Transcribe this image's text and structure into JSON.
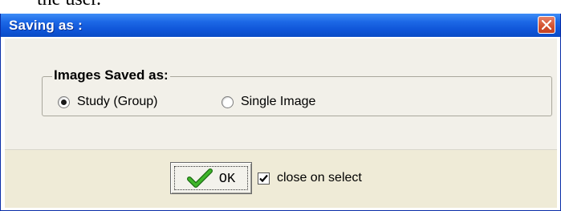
{
  "page_fragment_text": "the user.",
  "dialog": {
    "title": "Saving as :",
    "close_icon": "close-icon",
    "group": {
      "title": "Images Saved as:",
      "options": [
        {
          "label": "Study (Group)",
          "selected": true
        },
        {
          "label": "Single Image",
          "selected": false
        }
      ]
    },
    "ok_button": {
      "label": "OK",
      "icon": "checkmark-icon"
    },
    "close_on_select": {
      "label": "close on select",
      "checked": true
    }
  },
  "colors": {
    "titlebar": "#0f55d8",
    "close_button": "#d3522f",
    "upper_panel": "#f2f0e9",
    "lower_panel": "#efebd7",
    "checkmark": "#2e9a1e"
  }
}
